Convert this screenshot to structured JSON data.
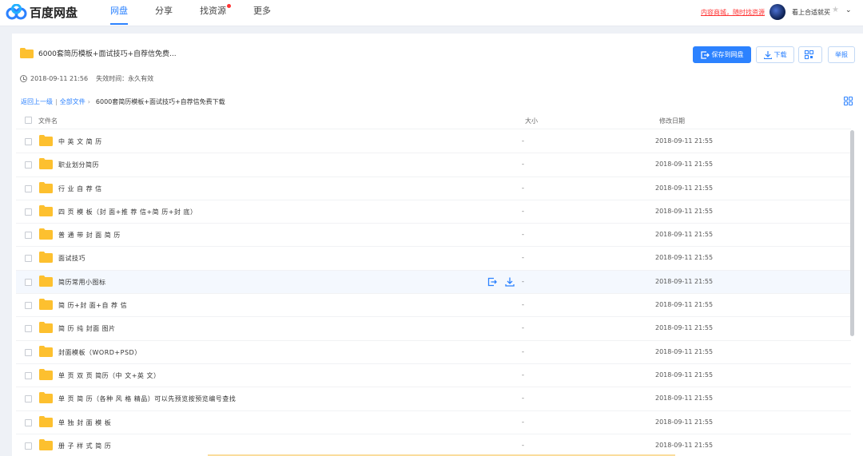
{
  "brand": {
    "name": "百度网盘"
  },
  "nav": [
    {
      "label": "网盘",
      "active": true
    },
    {
      "label": "分享",
      "active": false
    },
    {
      "label": "找资源",
      "active": false,
      "dot": true
    },
    {
      "label": "更多",
      "active": false
    }
  ],
  "header": {
    "promo": "内容商城，随时找资源",
    "username": "看上合适就买",
    "caret": "⌄"
  },
  "share": {
    "title": "6000套简历模板+面试技巧+自荐信免费...",
    "time": "2018-09-11 21:56",
    "expire": "失效时间：永久有效",
    "buttons": {
      "save": "保存到网盘",
      "download": "下载",
      "report": "举报"
    }
  },
  "breadcrumb": {
    "back": "返回上一级",
    "sep": "|",
    "all": "全部文件",
    "arrow": "›",
    "current": "6000套简历模板+面试技巧+自荐信免费下载"
  },
  "table": {
    "headers": {
      "name": "文件名",
      "size": "大小",
      "date": "修改日期"
    },
    "rows": [
      {
        "name": "中 英 文 简 历",
        "size": "-",
        "date": "2018-09-11 21:55"
      },
      {
        "name": "职业划分简历",
        "size": "-",
        "date": "2018-09-11 21:55"
      },
      {
        "name": "行 业 自 荐 信",
        "size": "-",
        "date": "2018-09-11 21:55"
      },
      {
        "name": "四 页 模 板（封 面+推 荐 信+简 历+封 底）",
        "size": "-",
        "date": "2018-09-11 21:55"
      },
      {
        "name": "普 通 带 封 面 简 历",
        "size": "-",
        "date": "2018-09-11 21:55"
      },
      {
        "name": "面试技巧",
        "size": "-",
        "date": "2018-09-11 21:55"
      },
      {
        "name": "简历常用小图标",
        "size": "-",
        "date": "2018-09-11 21:55",
        "hover": true
      },
      {
        "name": "简 历+封 面+自 荐 信",
        "size": "-",
        "date": "2018-09-11 21:55"
      },
      {
        "name": "简 历 纯 封面 图片",
        "size": "-",
        "date": "2018-09-11 21:55"
      },
      {
        "name": "封面模板（WORD+PSD）",
        "size": "-",
        "date": "2018-09-11 21:55"
      },
      {
        "name": "单 页 双 页 简历（中 文+英 文）",
        "size": "-",
        "date": "2018-09-11 21:55"
      },
      {
        "name": "单 页 简 历（各种 风 格 精品）可以先预览按预览编号查找",
        "size": "-",
        "date": "2018-09-11 21:55"
      },
      {
        "name": "单 独 封 面 模 板",
        "size": "-",
        "date": "2018-09-11 21:55"
      },
      {
        "name": "册 子 样 式 简 历",
        "size": "-",
        "date": "2018-09-11 21:55"
      }
    ]
  },
  "colors": {
    "accent": "#2c82ff",
    "folder": "#fdc02f",
    "promo": "#ff3333"
  },
  "icons": [
    "baidu-cloud-logo-icon",
    "clock-icon",
    "folder-icon",
    "save-to-disk-icon",
    "download-icon",
    "qr-code-icon",
    "grid-view-icon",
    "checkbox-icon"
  ]
}
